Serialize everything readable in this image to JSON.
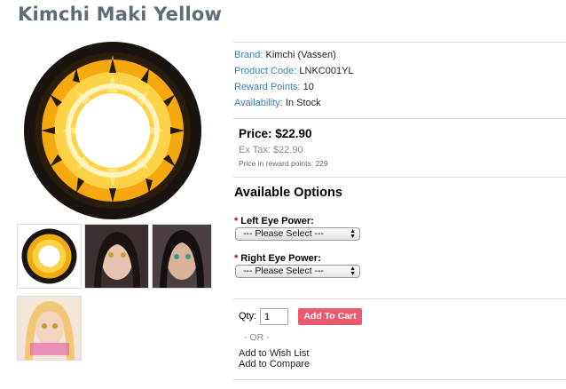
{
  "product": {
    "title": "Kimchi Maki Yellow",
    "brand_label": "Brand:",
    "brand_value": "Kimchi (Vassen)",
    "code_label": "Product Code:",
    "code_value": "LNKC001YL",
    "reward_label": "Reward Points:",
    "reward_value": "10",
    "availability_label": "Availability:",
    "availability_value": "In Stock"
  },
  "pricing": {
    "price": "Price: $22.90",
    "ex_tax": "Ex Tax: $22.90",
    "reward_price": "Price in reward points: 229"
  },
  "options": {
    "heading": "Available Options",
    "left_label": "Left Eye Power:",
    "left_value": "--- Please Select ---",
    "right_label": "Right Eye Power:",
    "right_value": "--- Please Select ---",
    "required_mark": "*"
  },
  "cart": {
    "qty_label": "Qty:",
    "qty_value": "1",
    "add_button": "Add To Cart",
    "or_text": "- OR -",
    "wishlist": "Add to Wish List",
    "compare": "Add to Compare"
  },
  "colors": {
    "link": "#3a7fc1",
    "title": "#5f6b78",
    "cart_button": "#e95a6f",
    "lens_yellow": "#f5b416"
  }
}
